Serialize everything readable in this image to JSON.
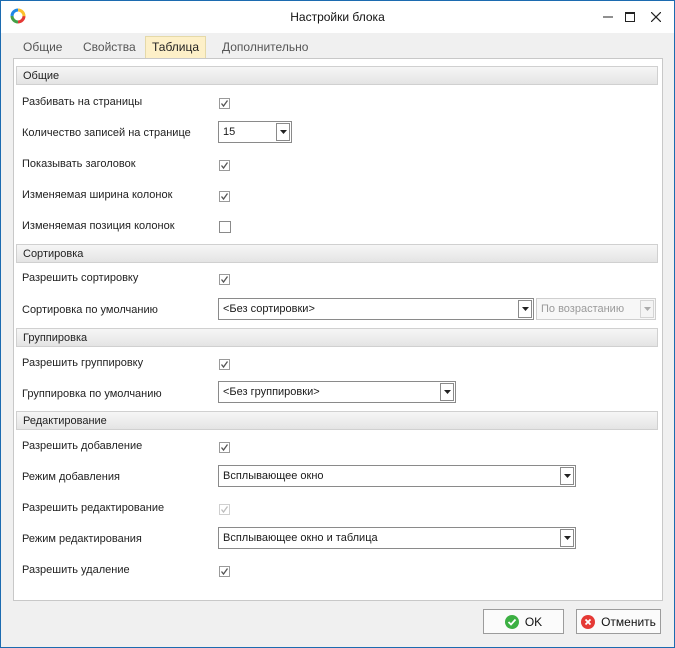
{
  "window": {
    "title": "Настройки блока"
  },
  "tabs": [
    {
      "label": "Общие"
    },
    {
      "label": "Свойства"
    },
    {
      "label": "Таблица"
    },
    {
      "label": "Дополнительно"
    }
  ],
  "sections": {
    "general": "Общие",
    "sorting": "Сортировка",
    "grouping": "Группировка",
    "editing": "Редактирование"
  },
  "fields": {
    "paging": {
      "label": "Разбивать на страницы",
      "checked": true
    },
    "records_per_page": {
      "label": "Количество записей на странице",
      "value": "15"
    },
    "show_header": {
      "label": "Показывать заголовок",
      "checked": true
    },
    "resizable_columns": {
      "label": "Изменяемая ширина колонок",
      "checked": true
    },
    "movable_columns": {
      "label": "Изменяемая позиция колонок",
      "checked": false
    },
    "allow_sorting": {
      "label": "Разрешить сортировку",
      "checked": true
    },
    "default_sort": {
      "label": "Сортировка по умолчанию",
      "value": "<Без сортировки>",
      "direction": "По возрастанию"
    },
    "allow_grouping": {
      "label": "Разрешить группировку",
      "checked": true
    },
    "default_group": {
      "label": "Группировка по умолчанию",
      "value": "<Без группировки>"
    },
    "allow_add": {
      "label": "Разрешить добавление",
      "checked": true
    },
    "add_mode": {
      "label": "Режим добавления",
      "value": "Всплывающее окно"
    },
    "allow_edit": {
      "label": "Разрешить редактирование",
      "checked": true,
      "disabled": true
    },
    "edit_mode": {
      "label": "Режим редактирования",
      "value": "Всплывающее окно и таблица"
    },
    "allow_delete": {
      "label": "Разрешить удаление",
      "checked": true
    }
  },
  "buttons": {
    "ok": "OK",
    "cancel": "Отменить"
  },
  "colors": {
    "accent": "#1c6bb0",
    "active_tab": "#fdf0c8",
    "ok_icon": "#3cb043",
    "cancel_icon": "#e53935"
  }
}
